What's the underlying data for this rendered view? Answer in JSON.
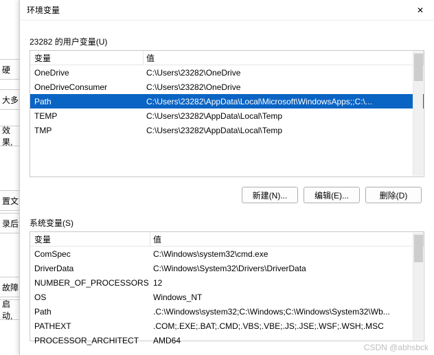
{
  "dialog": {
    "title": "环境变量",
    "close_glyph": "✕"
  },
  "user_section_label": "23282 的用户变量(U)",
  "sys_section_label": "系统变量(S)",
  "grid": {
    "col_name": "变量",
    "col_value": "值"
  },
  "user_vars": [
    {
      "name": "OneDrive",
      "value": "C:\\Users\\23282\\OneDrive",
      "selected": false
    },
    {
      "name": "OneDriveConsumer",
      "value": "C:\\Users\\23282\\OneDrive",
      "selected": false
    },
    {
      "name": "Path",
      "value": "C:\\Users\\23282\\AppData\\Local\\Microsoft\\WindowsApps;;C:\\...",
      "selected": true
    },
    {
      "name": "TEMP",
      "value": "C:\\Users\\23282\\AppData\\Local\\Temp",
      "selected": false
    },
    {
      "name": "TMP",
      "value": "C:\\Users\\23282\\AppData\\Local\\Temp",
      "selected": false
    }
  ],
  "sys_vars": [
    {
      "name": "ComSpec",
      "value": "C:\\Windows\\system32\\cmd.exe"
    },
    {
      "name": "DriverData",
      "value": "C:\\Windows\\System32\\Drivers\\DriverData"
    },
    {
      "name": "NUMBER_OF_PROCESSORS",
      "value": "12"
    },
    {
      "name": "OS",
      "value": "Windows_NT"
    },
    {
      "name": "Path",
      "value": ".C:\\Windows\\system32;C:\\Windows;C:\\Windows\\System32\\Wb..."
    },
    {
      "name": "PATHEXT",
      "value": ".COM;.EXE;.BAT;.CMD;.VBS;.VBE;.JS;.JSE;.WSF;.WSH;.MSC"
    },
    {
      "name": "PROCESSOR_ARCHITECT",
      "value": "AMD64"
    }
  ],
  "buttons": {
    "new": "新建(N)...",
    "edit": "编辑(E)...",
    "delete": "删除(D)"
  },
  "back_strip": {
    "h": "硬",
    "d": "大多",
    "x": "效果,",
    "z": "置文",
    "l": "录后",
    "g": "故障",
    "q": "启动,"
  },
  "watermark": "CSDN @abhsbck"
}
